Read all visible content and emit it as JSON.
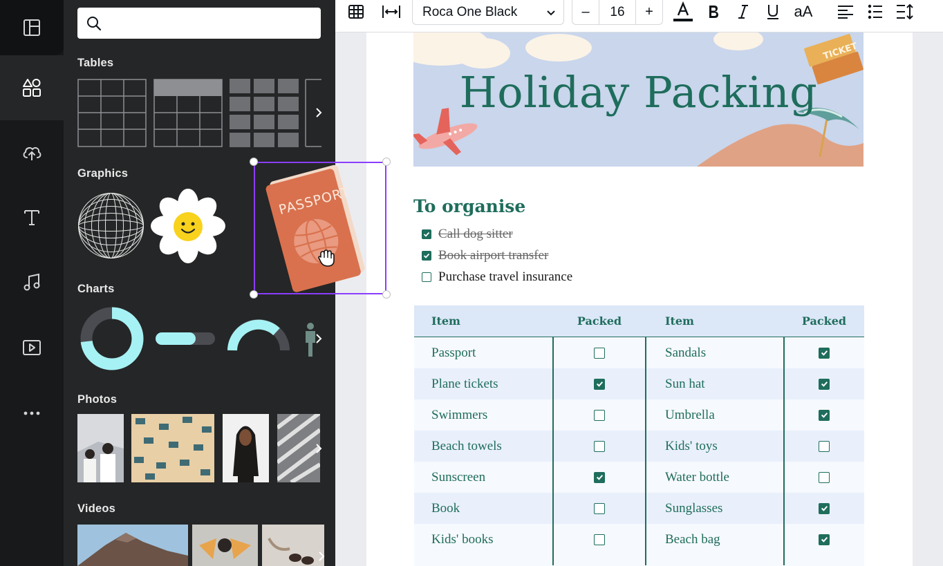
{
  "toolbar": {
    "font_name": "Roca One Black",
    "font_size": "16",
    "decrease_label": "–",
    "increase_label": "+",
    "case_label": "aA"
  },
  "sidebar": {
    "sections": {
      "tables": "Tables",
      "graphics": "Graphics",
      "charts": "Charts",
      "photos": "Photos",
      "videos": "Videos"
    },
    "graphics_items": {
      "passport_text": "PASSPORT"
    }
  },
  "document": {
    "banner_title": "Holiday Packing",
    "ticket_text": "TICKET",
    "organise_heading": "To organise",
    "todos": [
      {
        "text": "Call dog sitter",
        "checked": true
      },
      {
        "text": "Book airport transfer",
        "checked": true
      },
      {
        "text": "Purchase travel insurance",
        "checked": false
      }
    ],
    "table": {
      "headers": [
        "Item",
        "Packed",
        "Item",
        "Packed"
      ],
      "rows": [
        {
          "left_item": "Passport",
          "left_packed": false,
          "right_item": "Sandals",
          "right_packed": true
        },
        {
          "left_item": "Plane tickets",
          "left_packed": true,
          "right_item": "Sun hat",
          "right_packed": true
        },
        {
          "left_item": "Swimmers",
          "left_packed": false,
          "right_item": "Umbrella",
          "right_packed": true
        },
        {
          "left_item": "Beach towels",
          "left_packed": false,
          "right_item": "Kids' toys",
          "right_packed": false
        },
        {
          "left_item": "Sunscreen",
          "left_packed": true,
          "right_item": "Water bottle",
          "right_packed": false
        },
        {
          "left_item": "Book",
          "left_packed": false,
          "right_item": "Sunglasses",
          "right_packed": true
        },
        {
          "left_item": "Kids' books",
          "left_packed": false,
          "right_item": "Beach bag",
          "right_packed": true
        }
      ]
    }
  },
  "colors": {
    "accent_green": "#1f6d5c",
    "selection_purple": "#8b3dff",
    "rail_bg": "#18191b",
    "panel_bg": "#252627",
    "banner_bg": "#c9d6ec",
    "chart_cyan": "#a6f1f4",
    "passport_orange": "#d9714e"
  },
  "icons": {
    "rail": [
      "layout-icon",
      "elements-icon",
      "upload-cloud-icon",
      "text-icon",
      "music-icon",
      "video-icon",
      "more-icon"
    ],
    "toolbar": [
      "table-icon",
      "spacing-icon",
      "text-color-icon",
      "bold-icon",
      "italic-icon",
      "underline-icon",
      "align-left-icon",
      "bullet-list-icon",
      "line-spacing-icon"
    ]
  }
}
